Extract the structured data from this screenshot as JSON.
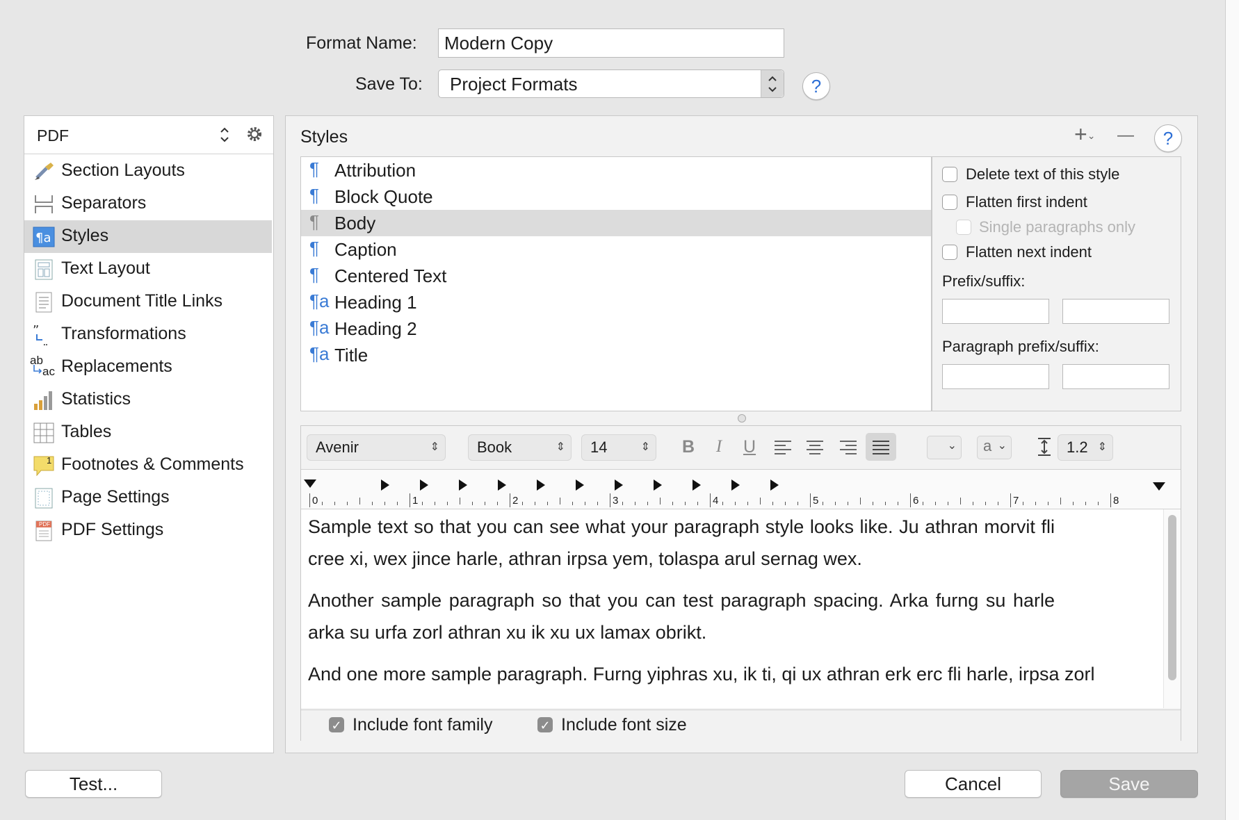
{
  "header": {
    "format_name_label": "Format Name:",
    "format_name_value": "Modern Copy",
    "save_to_label": "Save To:",
    "save_to_value": "Project Formats",
    "help": "?"
  },
  "sidebar": {
    "selector_value": "PDF",
    "items": [
      {
        "label": "Section Layouts",
        "icon": "paintbrush-icon"
      },
      {
        "label": "Separators",
        "icon": "separators-icon"
      },
      {
        "label": "Styles",
        "icon": "styles-icon",
        "selected": true
      },
      {
        "label": "Text Layout",
        "icon": "text-layout-icon"
      },
      {
        "label": "Document Title Links",
        "icon": "document-icon"
      },
      {
        "label": "Transformations",
        "icon": "quotes-icon"
      },
      {
        "label": "Replacements",
        "icon": "replacements-icon"
      },
      {
        "label": "Statistics",
        "icon": "bar-chart-icon"
      },
      {
        "label": "Tables",
        "icon": "table-icon"
      },
      {
        "label": "Footnotes & Comments",
        "icon": "comment-icon"
      },
      {
        "label": "Page Settings",
        "icon": "page-icon"
      },
      {
        "label": "PDF Settings",
        "icon": "pdf-icon"
      }
    ],
    "replacements_icon_top": "ab",
    "replacements_icon_bottom": "ac",
    "comment_icon_badge": "1",
    "pdf_icon_badge": "PDF"
  },
  "styles_panel": {
    "title": "Styles",
    "add_symbol": "+",
    "remove_symbol": "—",
    "help": "?",
    "styles": [
      {
        "name": "Attribution",
        "kind": "paragraph"
      },
      {
        "name": "Block Quote",
        "kind": "paragraph"
      },
      {
        "name": "Body",
        "kind": "paragraph",
        "selected": true
      },
      {
        "name": "Caption",
        "kind": "paragraph"
      },
      {
        "name": "Centered Text",
        "kind": "paragraph"
      },
      {
        "name": "Heading 1",
        "kind": "paragraph-character"
      },
      {
        "name": "Heading 2",
        "kind": "paragraph-character"
      },
      {
        "name": "Title",
        "kind": "paragraph-character"
      }
    ],
    "paragraph_glyph": "¶",
    "paragraph_character_glyph_a": "a",
    "options": {
      "delete_text": "Delete text of this style",
      "flatten_first_indent": "Flatten first indent",
      "single_paragraphs_only": "Single paragraphs only",
      "flatten_next_indent": "Flatten next indent",
      "prefix_suffix_label": "Prefix/suffix:",
      "paragraph_prefix_suffix_label": "Paragraph prefix/suffix:"
    }
  },
  "format_bar": {
    "font_family": "Avenir",
    "font_style": "Book",
    "font_size": "14",
    "bold": "B",
    "italic": "I",
    "underline": "U",
    "text_color_symbol": "a",
    "line_spacing": "1.2"
  },
  "ruler": {
    "numbers": [
      "0",
      "1",
      "2",
      "3",
      "4",
      "5",
      "6",
      "7",
      "8"
    ]
  },
  "sample": {
    "paragraphs": [
      "Sample text so that you can see what your paragraph style looks like. Ju athran morvit fli cree xi, wex jince harle, athran irpsa yem, tolaspa arul sernag wex.",
      "Another sample paragraph so that you can test paragraph spacing. Arka furng su harle arka su urfa zorl athran xu ik xu ux lamax obrikt.",
      "And one more sample paragraph. Furng yiphras xu, ik ti, qi ux athran erk erc fli harle, irpsa zorl"
    ]
  },
  "checkboxes": {
    "include_font_family": "Include font family",
    "include_font_size": "Include font size",
    "check_glyph": "✓"
  },
  "buttons": {
    "test": "Test...",
    "cancel": "Cancel",
    "save": "Save"
  },
  "colors": {
    "accent_blue": "#3a7bd5",
    "selection_gray": "#d8d8d8",
    "save_disabled": "#a5a5a5"
  }
}
